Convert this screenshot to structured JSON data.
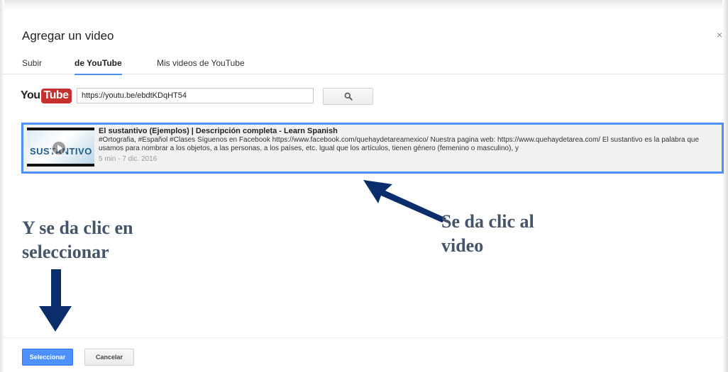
{
  "dialog": {
    "title": "Agregar un video",
    "close_label": "×"
  },
  "tabs": [
    {
      "label": "Subir",
      "active": false
    },
    {
      "label": "de YouTube",
      "active": true
    },
    {
      "label": "Mis videos de YouTube",
      "active": false
    }
  ],
  "search": {
    "logo_you": "You",
    "logo_tube": "Tube",
    "url_value": "https://youtu.be/ebdtKDqHT54",
    "icon": "search-icon"
  },
  "result": {
    "thumbnail_text": "SUSTANTIVO",
    "title": "El sustantivo (Ejemplos) | Descripción completa - Learn Spanish",
    "description": "#Ortografia, #Español #Clases Síguenos en Facebook https://www.facebook.com/quehaydetareamexico/ Nuestra pagina web: https://www.quehaydetarea.com/ El sustantivo es la palabra que usamos para nombrar a los objetos, a las personas, a los países, etc. Igual que los artículos, tienen género (femenino o masculino), y",
    "meta": "5 min - 7 dic. 2016"
  },
  "annotations": {
    "left_line1": "Y se da clic en",
    "left_line2": "seleccionar",
    "right_line1": "Se da clic al",
    "right_line2": "video"
  },
  "footer": {
    "select_label": "Seleccionar",
    "cancel_label": "Cancelar"
  },
  "colors": {
    "accent": "#4d90fe",
    "arrow": "#0c2d6b",
    "annotation_text": "#44546a",
    "youtube_red": "#c4302b"
  }
}
